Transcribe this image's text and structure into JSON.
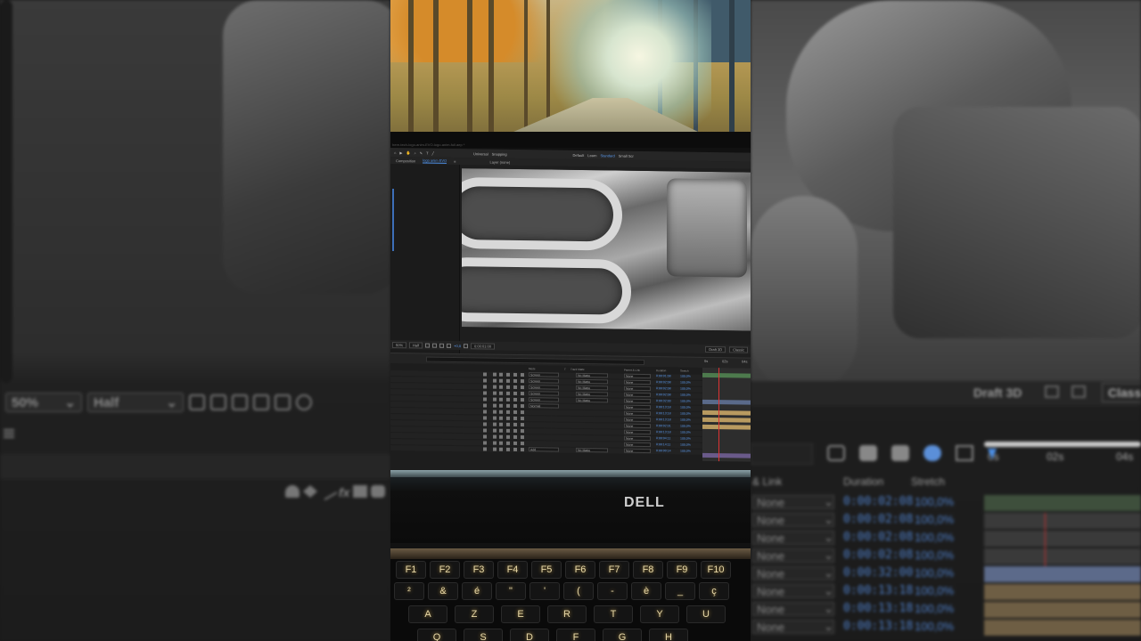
{
  "background_left": {
    "zoom_select": "50%",
    "resolution_select": "Half"
  },
  "background_right": {
    "draft3d_label": "Draft 3D",
    "classic_label": "Classi",
    "ruler": [
      "0s",
      "02s",
      "04s"
    ],
    "parent_header": "& Link",
    "duration_header": "Duration",
    "stretch_header": "Stretch",
    "rows": [
      {
        "parent": "None",
        "duration": "0:00:02:08",
        "stretch": "100,0%"
      },
      {
        "parent": "None",
        "duration": "0:00:02:08",
        "stretch": "100,0%"
      },
      {
        "parent": "None",
        "duration": "0:00:02:08",
        "stretch": "100,0%"
      },
      {
        "parent": "None",
        "duration": "0:00:02:08",
        "stretch": "100,0%"
      },
      {
        "parent": "None",
        "duration": "0:00:32:00",
        "stretch": "100,0%"
      },
      {
        "parent": "None",
        "duration": "0:00:13:18",
        "stretch": "100,0%"
      },
      {
        "parent": "None",
        "duration": "0:00:13:18",
        "stretch": "100,0%"
      },
      {
        "parent": "None",
        "duration": "0:00:13:18",
        "stretch": "100,0%"
      }
    ]
  },
  "monitor": {
    "url_text": "here-tech-logo-anim-EVO-logo-anim-full.aep *"
  },
  "ae": {
    "menu_items": [
      "Composition",
      "logo anim EVO",
      "≡",
      "Layer (none)"
    ],
    "workspace": [
      "Universal",
      "Snapping",
      "Default",
      "Learn",
      "Standard",
      "Small Scr"
    ],
    "comp_tab": "logo anim EVO",
    "viewer_zoom": "50%",
    "viewer_res": "Half",
    "viewer_exposure": "+0,0",
    "viewer_time": "0:00:01:00",
    "draft3d": "Draft 3D",
    "classic": "Classic",
    "timeline_headers": [
      "Mode",
      "T",
      "Track Matte",
      "Parent & Link",
      "Duration",
      "Stretch"
    ],
    "timeline_ruler": [
      "0s",
      "02s",
      "04s"
    ],
    "rows": [
      {
        "mode": "Screen",
        "matte": "No Matte",
        "parent": "None",
        "duration": "0:00:01:08",
        "stretch": "100,0%"
      },
      {
        "mode": "Screen",
        "matte": "No Matte",
        "parent": "None",
        "duration": "0:00:02:08",
        "stretch": "100,0%"
      },
      {
        "mode": "Screen",
        "matte": "No Matte",
        "parent": "None",
        "duration": "0:00:02:08",
        "stretch": "100,0%"
      },
      {
        "mode": "Screen",
        "matte": "No Matte",
        "parent": "None",
        "duration": "0:00:02:08",
        "stretch": "100,0%"
      },
      {
        "mode": "Screen",
        "matte": "No Matte",
        "parent": "None",
        "duration": "0:00:32:00",
        "stretch": "100,0%"
      },
      {
        "mode": "Normal",
        "matte": "",
        "parent": "None",
        "duration": "0:00:13:18",
        "stretch": "100,0%"
      },
      {
        "mode": "",
        "matte": "",
        "parent": "None",
        "duration": "0:00:13:18",
        "stretch": "100,0%"
      },
      {
        "mode": "",
        "matte": "",
        "parent": "None",
        "duration": "0:00:13:18",
        "stretch": "100,0%"
      },
      {
        "mode": "",
        "matte": "",
        "parent": "None",
        "duration": "0:00:02:01",
        "stretch": "100,0%"
      },
      {
        "mode": "",
        "matte": "",
        "parent": "None",
        "duration": "0:00:13:18",
        "stretch": "100,0%"
      },
      {
        "mode": "",
        "matte": "",
        "parent": "None",
        "duration": "0:00:04:11",
        "stretch": "100,0%"
      },
      {
        "mode": "",
        "matte": "",
        "parent": "None",
        "duration": "0:00:14:11",
        "stretch": "100,0%"
      },
      {
        "mode": "Add",
        "matte": "No Matte",
        "parent": "None",
        "duration": "0:00:00:14",
        "stretch": "100,0%"
      }
    ]
  },
  "laptop": {
    "brand": "DELL",
    "keys_row1": [
      "F1",
      "F2",
      "F3",
      "F4",
      "F5",
      "F6",
      "F7",
      "F8",
      "F9",
      "F10"
    ],
    "keys_row2": [
      "²",
      "&",
      "é",
      "\"",
      "'",
      "(",
      "-",
      "è",
      "_",
      "ç"
    ],
    "keys_row3": [
      "A",
      "Z",
      "E",
      "R",
      "T",
      "Y",
      "U"
    ],
    "keys_row4": [
      "Q",
      "S",
      "D",
      "F",
      "G",
      "H"
    ]
  },
  "colors": {
    "accent_blue": "#4c8fe6",
    "playhead_red": "#d33333",
    "key_glow": "#c9a24a"
  }
}
